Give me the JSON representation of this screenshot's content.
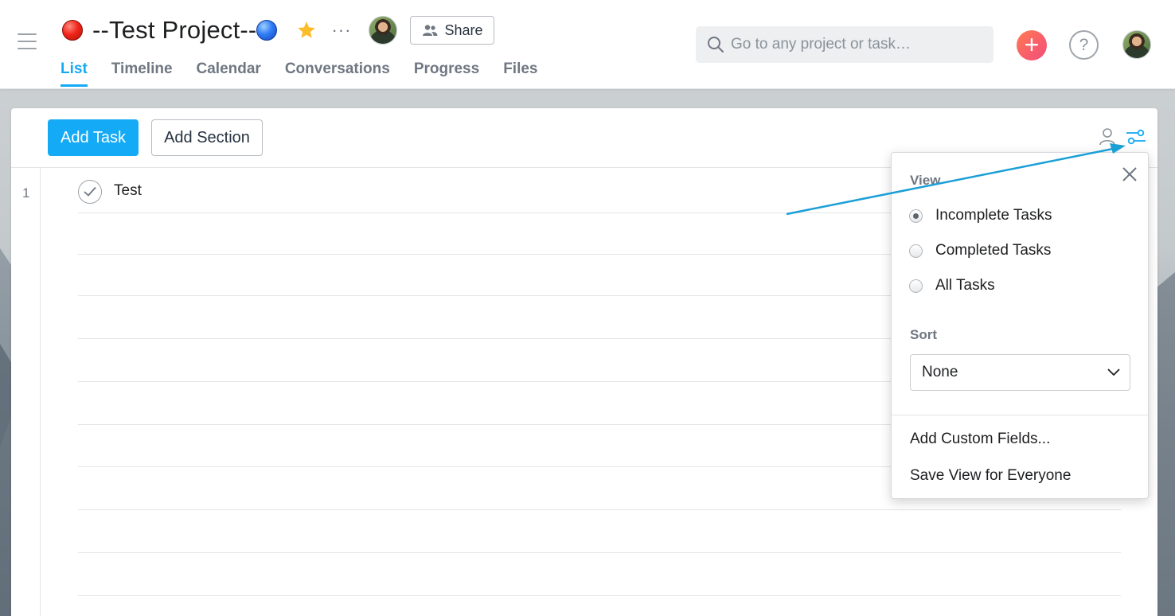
{
  "header": {
    "project_title": "--Test Project--",
    "share_label": "Share",
    "more_label": "···",
    "tabs": [
      {
        "label": "List"
      },
      {
        "label": "Timeline"
      },
      {
        "label": "Calendar"
      },
      {
        "label": "Conversations"
      },
      {
        "label": "Progress"
      },
      {
        "label": "Files"
      }
    ],
    "active_tab": "List",
    "search_placeholder": "Go to any project or task…",
    "add_label": "+",
    "help_label": "?"
  },
  "toolbar": {
    "add_task_label": "Add Task",
    "add_section_label": "Add Section"
  },
  "tasks": [
    {
      "row_number": "1",
      "name": "Test"
    }
  ],
  "view_menu": {
    "view_heading": "View",
    "options": [
      {
        "label": "Incomplete Tasks",
        "selected": true
      },
      {
        "label": "Completed Tasks",
        "selected": false
      },
      {
        "label": "All Tasks",
        "selected": false
      }
    ],
    "sort_heading": "Sort",
    "sort_value": "None",
    "actions": [
      {
        "label": "Add Custom Fields..."
      },
      {
        "label": "Save View for Everyone"
      }
    ]
  },
  "colors": {
    "accent": "#14aaf5",
    "add_button": "#f85d6c",
    "annotation_arrow": "#1a9fd6"
  },
  "icons": [
    "hamburger-icon",
    "red-dot-icon",
    "blue-dot-icon",
    "star-icon",
    "more-icon",
    "share-people-icon",
    "search-icon",
    "plus-icon",
    "help-icon",
    "person-icon",
    "sliders-icon",
    "checkmark-icon",
    "close-icon",
    "chevron-down-icon"
  ]
}
